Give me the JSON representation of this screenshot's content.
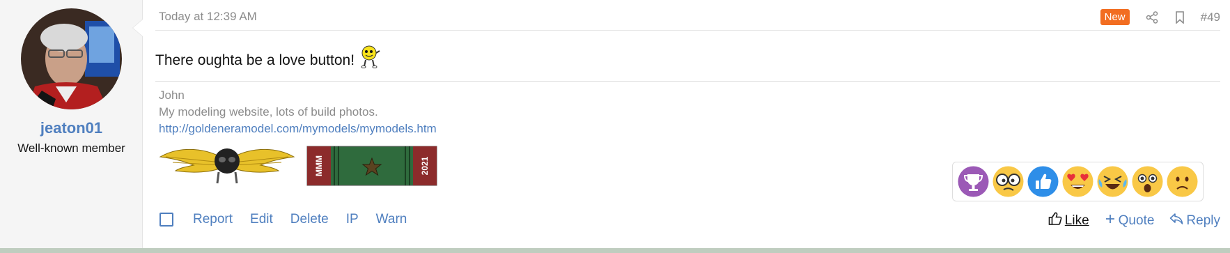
{
  "user": {
    "name": "jeaton01",
    "title": "Well-known member"
  },
  "post": {
    "date": "Today at 12:39 AM",
    "badge": "New",
    "number": "#49",
    "message": "There oughta be a love button!"
  },
  "signature": {
    "name": "John",
    "description": "My modeling website, lots of build photos.",
    "link": "http://goldeneramodel.com/mymodels/mymodels.htm",
    "ribbon_text_left": "MMM",
    "ribbon_text_right": "2021"
  },
  "reactions": [
    "trophy-icon",
    "confused-emoji",
    "like-icon",
    "heart-eyes-emoji",
    "laughing-emoji",
    "astonished-emoji",
    "sad-emoji"
  ],
  "actions": {
    "report": "Report",
    "edit": "Edit",
    "delete": "Delete",
    "ip": "IP",
    "warn": "Warn",
    "like": "Like",
    "quote": "Quote",
    "reply": "Reply"
  },
  "colors": {
    "accent": "#4f7fbf",
    "badge": "#f26d21",
    "muted": "#8c8c8c"
  }
}
